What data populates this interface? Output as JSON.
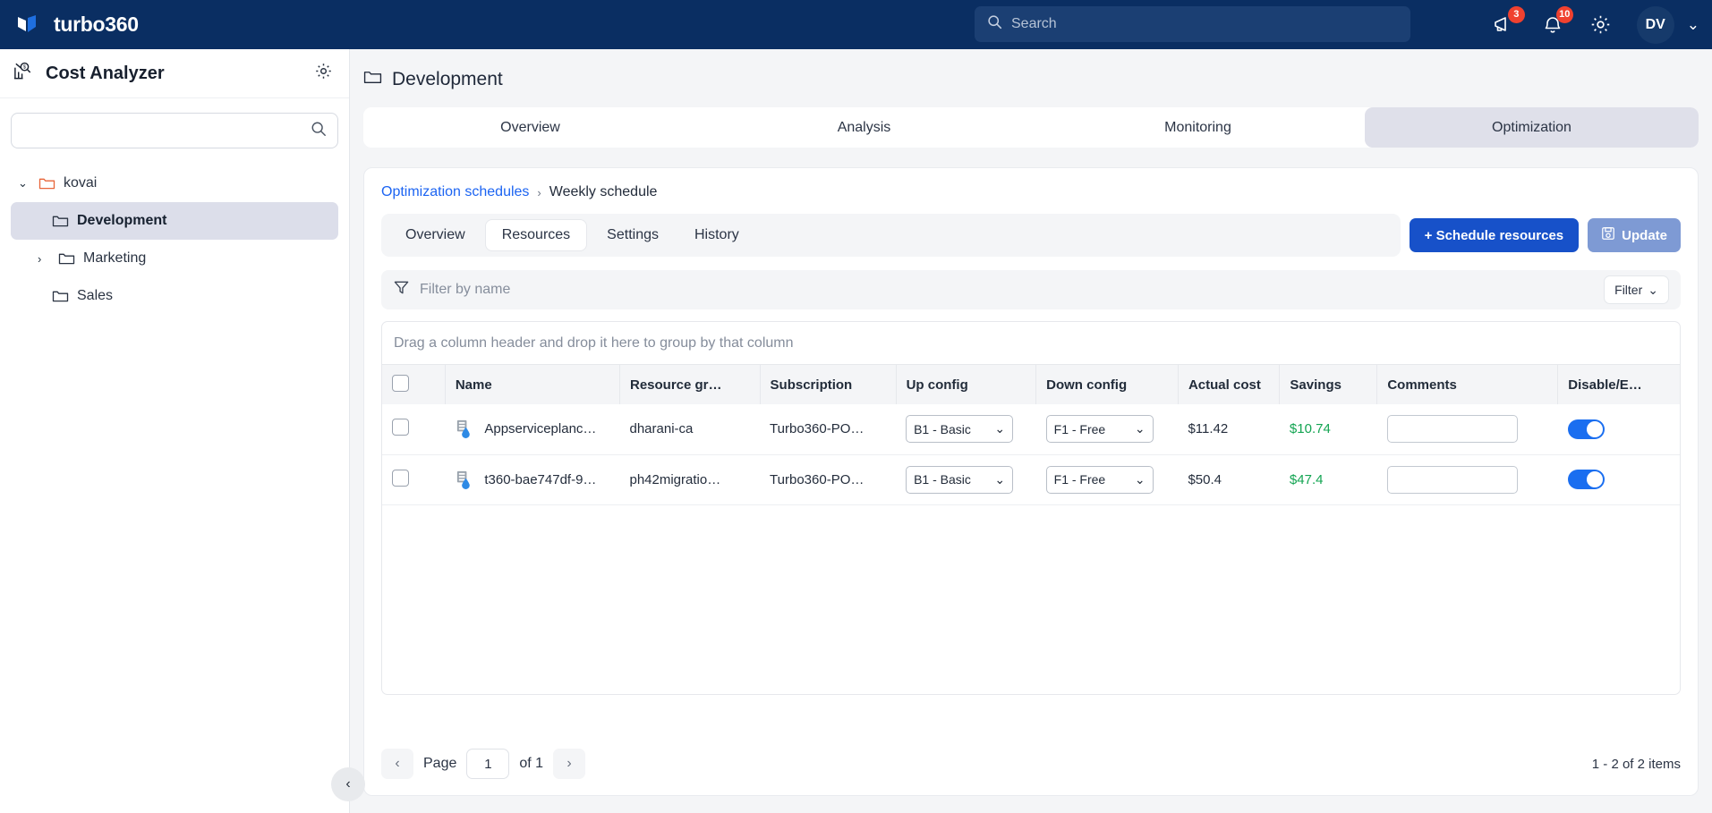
{
  "topbar": {
    "brand": "turbo360",
    "search_placeholder": "Search",
    "search_value": "",
    "megaphone_badge": "3",
    "bell_badge": "10",
    "avatar_initials": "DV"
  },
  "sidebar": {
    "title": "Cost Analyzer",
    "search_placeholder": "",
    "search_value": "",
    "tree": [
      {
        "label": "kovai",
        "level": 1,
        "expanded": true,
        "selected": false
      },
      {
        "label": "Development",
        "level": 2,
        "expanded": false,
        "selected": true
      },
      {
        "label": "Marketing",
        "level": 2,
        "expanded": false,
        "selected": false
      },
      {
        "label": "Sales",
        "level": 2,
        "expanded": false,
        "selected": false
      }
    ]
  },
  "main": {
    "page_title": "Development",
    "tabs": [
      {
        "label": "Overview",
        "active": false
      },
      {
        "label": "Analysis",
        "active": false
      },
      {
        "label": "Monitoring",
        "active": false
      },
      {
        "label": "Optimization",
        "active": true
      }
    ],
    "breadcrumb": {
      "link": "Optimization schedules",
      "separator": "›",
      "current": "Weekly schedule"
    },
    "subtabs": [
      {
        "label": "Overview",
        "active": false
      },
      {
        "label": "Resources",
        "active": true
      },
      {
        "label": "Settings",
        "active": false
      },
      {
        "label": "History",
        "active": false
      }
    ],
    "actions": {
      "schedule_label": "+ Schedule resources",
      "update_label": "Update"
    },
    "filter": {
      "placeholder": "Filter by name",
      "value": "",
      "button_label": "Filter"
    },
    "table": {
      "group_hint": "Drag a column header and drop it here to group by that column",
      "columns": [
        "",
        "Name",
        "Resource gr…",
        "Subscription",
        "Up config",
        "Down config",
        "Actual cost",
        "Savings",
        "Comments",
        "Disable/E…"
      ],
      "rows": [
        {
          "checked": false,
          "name": "Appserviceplanc…",
          "resource_group": "dharani-ca",
          "subscription": "Turbo360-PO…",
          "up_config": "B1 - Basic",
          "down_config": "F1 - Free",
          "actual_cost": "$11.42",
          "savings": "$10.74",
          "comment": "",
          "enabled": true
        },
        {
          "checked": false,
          "name": "t360-bae747df-9…",
          "resource_group": "ph42migratio…",
          "subscription": "Turbo360-PO…",
          "up_config": "B1 - Basic",
          "down_config": "F1 - Free",
          "actual_cost": "$50.4",
          "savings": "$47.4",
          "comment": "",
          "enabled": true
        }
      ]
    },
    "pagination": {
      "page_label": "Page",
      "page_value": "1",
      "of_label": "of 1",
      "items_label": "1 - 2 of 2 items"
    }
  },
  "colors": {
    "brand_navy": "#0a2e62",
    "accent_blue": "#1751c9",
    "link_blue": "#1c64f2",
    "savings_green": "#13a452",
    "badge_red": "#f0412f",
    "toggle_on": "#1a6ef0"
  }
}
